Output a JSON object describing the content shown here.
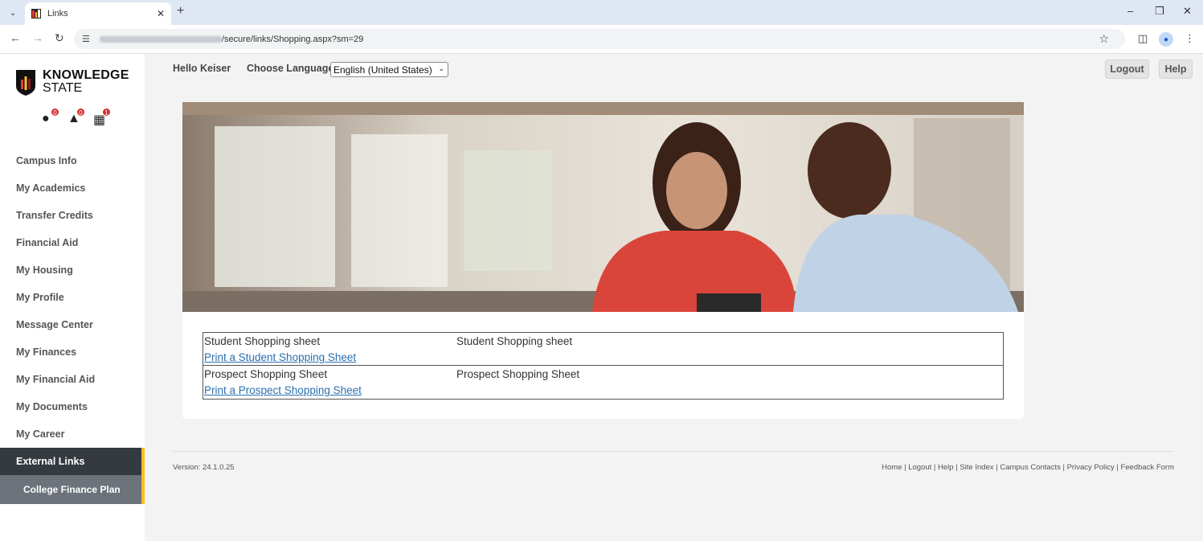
{
  "browser": {
    "tab_title": "Links",
    "url_path": "/secure/links/Shopping.aspx?sm=29"
  },
  "brand": {
    "line1": "KNOWLEDGE",
    "line2": "STATE",
    "colors": {
      "dark": "#343a40",
      "accent": "#f4c11e",
      "badge": "#d32f2f",
      "link": "#2a6fb0"
    }
  },
  "badges": [
    {
      "icon": "alert-icon",
      "count": "0"
    },
    {
      "icon": "bell-icon",
      "count": "0"
    },
    {
      "icon": "calendar-icon",
      "count": "1"
    }
  ],
  "nav": {
    "items": [
      {
        "label": "Campus Info"
      },
      {
        "label": "My Academics"
      },
      {
        "label": "Transfer Credits"
      },
      {
        "label": "Financial Aid"
      },
      {
        "label": "My Housing"
      },
      {
        "label": "My Profile"
      },
      {
        "label": "Message Center"
      },
      {
        "label": "My Finances"
      },
      {
        "label": "My Financial Aid"
      },
      {
        "label": "My Documents"
      },
      {
        "label": "My Career"
      },
      {
        "label": "External Links"
      }
    ],
    "sub_item": "College Finance Plan"
  },
  "header": {
    "greeting": "Hello Keiser",
    "language_label": "Choose Language :",
    "language_value": "English (United States)",
    "logout": "Logout",
    "help": "Help"
  },
  "links": [
    {
      "title": "Student Shopping sheet",
      "description": "Student Shopping sheet",
      "link_text": "Print a Student Shopping Sheet"
    },
    {
      "title": "Prospect Shopping Sheet",
      "description": "Prospect Shopping Sheet",
      "link_text": "Print a Prospect Shopping Sheet"
    }
  ],
  "footer": {
    "version": "Version: 24.1.0.25",
    "links": [
      "Home",
      "Logout",
      "Help",
      "Site Index",
      "Campus Contacts",
      "Privacy Policy",
      "Feedback Form"
    ]
  }
}
